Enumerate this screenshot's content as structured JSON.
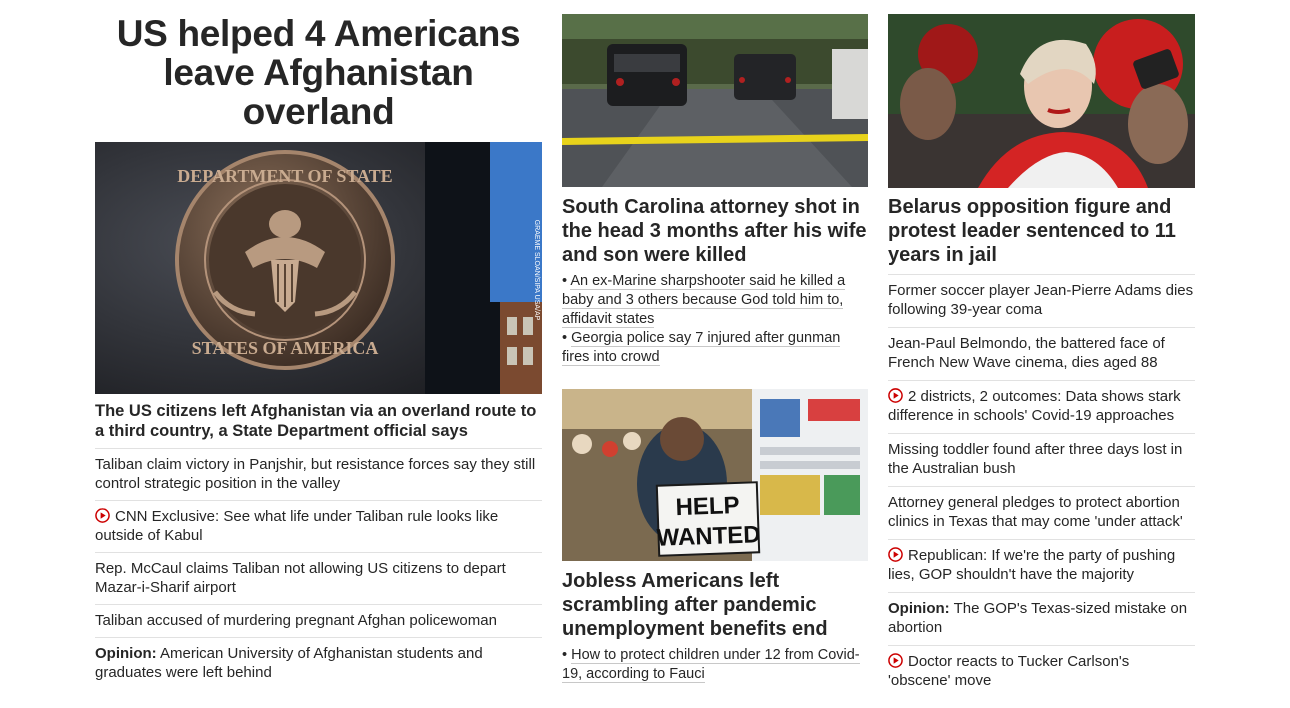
{
  "main": {
    "headline": "US helped 4 Americans leave Afghanistan overland",
    "image_credit": "GRAEME SLOAN/SIPA USA/AP",
    "subhead": "The US citizens left Afghanistan via an overland route to a third country, a State Department official says",
    "stories": [
      {
        "text": "Taliban claim victory in Panjshir, but resistance forces say they still control strategic position in the valley",
        "video": false,
        "prefix": ""
      },
      {
        "text": "CNN Exclusive: See what life under Taliban rule looks like outside of Kabul",
        "video": true,
        "prefix": ""
      },
      {
        "text": "Rep. McCaul claims Taliban not allowing US citizens to depart Mazar-i-Sharif airport",
        "video": false,
        "prefix": ""
      },
      {
        "text": "Taliban accused of murdering pregnant Afghan policewoman",
        "video": false,
        "prefix": ""
      },
      {
        "text": "American University of Afghanistan students and graduates were left behind",
        "video": false,
        "prefix": "Opinion:"
      }
    ]
  },
  "card_sc": {
    "headline": "South Carolina attorney shot in the head 3 months after his wife and son were killed",
    "bullets": [
      "An ex-Marine sharpshooter said he killed a baby and 3 others because God told him to, affidavit states",
      "Georgia police say 7 injured after gunman fires into crowd"
    ]
  },
  "card_jobs": {
    "headline": "Jobless Americans left scrambling after pandemic unemployment benefits end",
    "sign_text": [
      "HELP",
      "WANTED"
    ],
    "bullets": [
      "How to protect children under 12 from Covid-19, according to Fauci"
    ]
  },
  "card_belarus": {
    "headline": "Belarus opposition figure and protest leader sentenced to 11 years in jail",
    "stories": [
      {
        "text": "Former soccer player Jean-Pierre Adams dies following 39-year coma",
        "video": false,
        "prefix": ""
      },
      {
        "text": "Jean-Paul Belmondo, the battered face of French New Wave cinema, dies aged 88",
        "video": false,
        "prefix": ""
      },
      {
        "text": "2 districts, 2 outcomes: Data shows stark difference in schools' Covid-19 approaches",
        "video": true,
        "prefix": ""
      },
      {
        "text": "Missing toddler found after three days lost in the Australian bush",
        "video": false,
        "prefix": ""
      },
      {
        "text": "Attorney general pledges to protect abortion clinics in Texas that may come 'under attack'",
        "video": false,
        "prefix": ""
      },
      {
        "text": "Republican: If we're the party of pushing lies, GOP shouldn't have the majority",
        "video": true,
        "prefix": ""
      },
      {
        "text": "The GOP's Texas-sized mistake on abortion",
        "video": false,
        "prefix": "Opinion:"
      },
      {
        "text": "Doctor reacts to Tucker Carlson's 'obscene' move",
        "video": true,
        "prefix": ""
      }
    ]
  },
  "colors": {
    "video_icon": "#cc0000",
    "divider": "#e1e1e1",
    "text": "#262626"
  },
  "icons": {
    "video": "play-circle-icon"
  }
}
